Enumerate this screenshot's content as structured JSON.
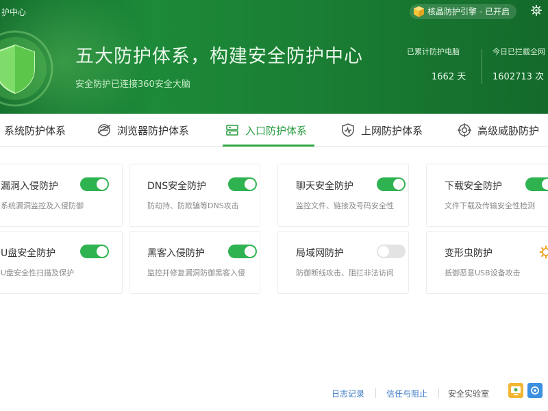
{
  "header": {
    "app_title": "护中心",
    "headline": "五大防护体系，构建安全防护中心",
    "subline": "安全防护已连接360安全大脑",
    "engine_label": "核晶防护引擎 - 已开启",
    "stats": [
      {
        "label": "已累计防护电脑",
        "value": "1662 天"
      },
      {
        "label": "今日已拦截全网",
        "value": "1602713 次"
      }
    ],
    "colors": {
      "brand_green": "#1c8a38",
      "accent_green": "#2ea845"
    }
  },
  "tabs": [
    {
      "label": "系统防护体系",
      "icon": "system-shield-icon",
      "active": false
    },
    {
      "label": "浏览器防护体系",
      "icon": "browser-icon",
      "active": false
    },
    {
      "label": "入口防护体系",
      "icon": "server-entry-icon",
      "active": true
    },
    {
      "label": "上网防护体系",
      "icon": "network-shield-icon",
      "active": false
    },
    {
      "label": "高级威胁防护",
      "icon": "target-icon",
      "active": false
    }
  ],
  "cards": [
    {
      "title": "漏洞入侵防护",
      "desc": "系统漏洞监控及入侵防御",
      "enabled": true
    },
    {
      "title": "DNS安全防护",
      "desc": "防劫持、防欺骗等DNS攻击",
      "enabled": true
    },
    {
      "title": "聊天安全防护",
      "desc": "监控文件、链接及号码安全性",
      "enabled": true
    },
    {
      "title": "下载安全防护",
      "desc": "文件下载及传输安全性检测",
      "enabled": true
    },
    {
      "title": "U盘安全防护",
      "desc": "U盘安全性扫描及保护",
      "enabled": true
    },
    {
      "title": "黑客入侵防护",
      "desc": "监控并修复漏洞防御黑客入侵",
      "enabled": true
    },
    {
      "title": "局域网防护",
      "desc": "防御断线攻击、阻拦非法访问",
      "enabled": false
    },
    {
      "title": "变形虫防护",
      "desc": "抵御恶意USB设备攻击",
      "enabled": null,
      "icon": "gear-warning-icon"
    }
  ],
  "footer": {
    "log_label": "日志记录",
    "trust_label": "信任与阻止",
    "lab_label": "安全实验室"
  }
}
